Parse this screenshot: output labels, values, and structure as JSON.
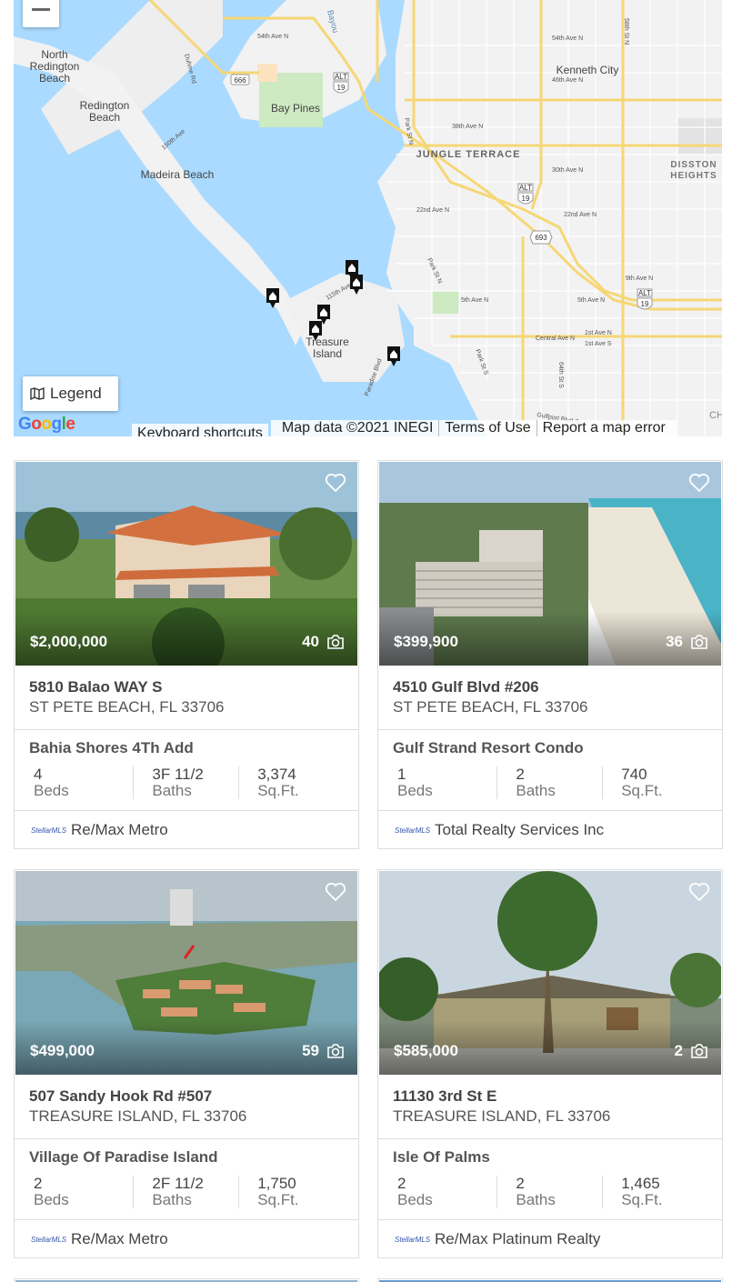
{
  "map": {
    "labels": {
      "north_redington_beach": "North\nRedington\nBeach",
      "redington_beach": "Redington\nBeach",
      "bay_pines": "Bay Pines",
      "madeira_beach": "Madeira Beach",
      "jungle_terrace": "JUNGLE TERRACE",
      "kenneth_city": "Kenneth City",
      "disston_heights": "DISSTON\nHEIGHTS",
      "treasure_island": "Treasure\nIsland",
      "bayou": "Bayou",
      "ave_54": "54th Ave N",
      "ave_46": "46th Ave N",
      "ave_54b": "54th Ave N",
      "ave_38": "38th Ave N",
      "ave_30": "30th Ave N",
      "ave_22": "22nd Ave N",
      "ave_22b": "22nd Ave N",
      "ave_9": "9th Ave N",
      "ave_5": "5th Ave N",
      "ave_5b": "5th Ave N",
      "central": "Central Ave N",
      "first_ave_n": "1st Ave N",
      "first_ave_s": "1st Ave S",
      "dr_duhme": "Duhme Rd",
      "ave_150": "150th Ave",
      "ave_115": "115th Ave",
      "park_st": "Park St N",
      "park_st_s": "Park St S",
      "paradise": "Paradise Blvd",
      "gulfport": "Gulfport Blvd S",
      "st_64": "64th St S",
      "st_58": "58th St N",
      "route_666": "666",
      "route_19": "19",
      "route_19b": "19",
      "route_19c": "19",
      "route_693": "693",
      "alt": "ALT",
      "ch": "CH"
    },
    "zoom_out_label": "−",
    "legend_label": "Legend",
    "google_logo": "Google",
    "keyboard_shortcuts": "Keyboard shortcuts",
    "map_data": "Map data ©2021 INEGI",
    "terms": "Terms of Use",
    "report": "Report a map error"
  },
  "listings": [
    {
      "price": "$2,000,000",
      "photo_count": "40",
      "street": "5810 Balao WAY S",
      "city": "ST PETE BEACH, FL 33706",
      "subdivision": "Bahia Shores 4Th Add",
      "beds": "4",
      "beds_label": "Beds",
      "baths": "3F  11/2",
      "baths_label": "Baths",
      "sqft": "3,374",
      "sqft_label": "Sq.Ft.",
      "mls": "StellarMLS",
      "broker": "Re/Max Metro"
    },
    {
      "price": "$399,900",
      "photo_count": "36",
      "street": "4510 Gulf Blvd #206",
      "city": "ST PETE BEACH, FL 33706",
      "subdivision": "Gulf Strand Resort Condo",
      "beds": "1",
      "beds_label": "Beds",
      "baths": "2",
      "baths_label": "Baths",
      "sqft": "740",
      "sqft_label": "Sq.Ft.",
      "mls": "StellarMLS",
      "broker": "Total Realty Services Inc"
    },
    {
      "price": "$499,000",
      "photo_count": "59",
      "street": "507 Sandy Hook Rd #507",
      "city": "TREASURE ISLAND, FL 33706",
      "subdivision": "Village Of Paradise Island",
      "beds": "2",
      "beds_label": "Beds",
      "baths": "2F  11/2",
      "baths_label": "Baths",
      "sqft": "1,750",
      "sqft_label": "Sq.Ft.",
      "mls": "StellarMLS",
      "broker": "Re/Max Metro"
    },
    {
      "price": "$585,000",
      "photo_count": "2",
      "street": "11130 3rd St E",
      "city": "TREASURE ISLAND, FL 33706",
      "subdivision": "Isle Of Palms",
      "beds": "2",
      "beds_label": "Beds",
      "baths": "2",
      "baths_label": "Baths",
      "sqft": "1,465",
      "sqft_label": "Sq.Ft.",
      "mls": "StellarMLS",
      "broker": "Re/Max Platinum Realty"
    }
  ],
  "colors": {
    "water": "#a9d3f0",
    "land": "#f1f1f1",
    "road_major": "#f6d776",
    "park": "#cdeac2",
    "text_dark": "#333333"
  }
}
